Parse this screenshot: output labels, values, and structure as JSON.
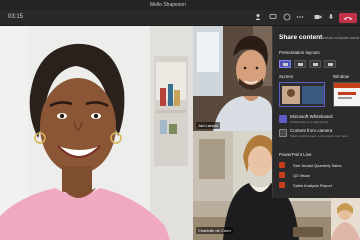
{
  "window": {
    "title": "Mello Shapeson"
  },
  "toolbar": {
    "timer": "03:15"
  },
  "participants": {
    "top_right_name": "Jad Larsen",
    "bottom_right_name": "Charlotte de Crum"
  },
  "share_panel": {
    "title": "Share content",
    "subtitle": "Include computer sound",
    "presenter_layouts": "Presentation layouts",
    "screen_label": "Screen",
    "window_label": "Window",
    "items": [
      {
        "title": "Microsoft Whiteboard",
        "subtitle": "Collaborate on a whiteboard"
      },
      {
        "title": "Content from camera",
        "subtitle": "Share a whiteboard, a document, and more"
      }
    ],
    "powerpoint_label": "PowerPoint Live",
    "files": [
      "Sarr Arcaid Quarterly Sales",
      "Q3 Vision",
      "Sales Analysis Report"
    ]
  },
  "colors": {
    "accent": "#5b5fc7",
    "leave": "#c4314b",
    "powerpoint": "#c43e1c",
    "panel_bg": "#2b2b2b"
  }
}
